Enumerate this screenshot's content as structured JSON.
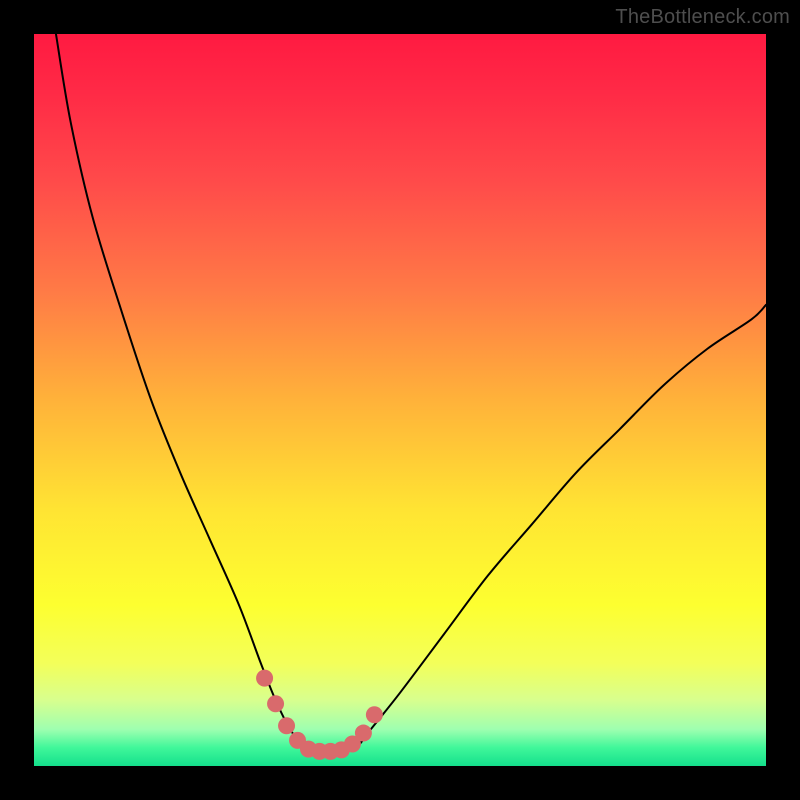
{
  "watermark": "TheBottleneck.com",
  "chart_data": {
    "type": "line",
    "title": "",
    "xlabel": "",
    "ylabel": "",
    "xlim": [
      0,
      100
    ],
    "ylim": [
      0,
      100
    ],
    "series": [
      {
        "name": "bottleneck-curve",
        "x": [
          3,
          5,
          8,
          12,
          16,
          20,
          24,
          28,
          31,
          33,
          35,
          37,
          39,
          42,
          44,
          46,
          50,
          56,
          62,
          68,
          74,
          80,
          86,
          92,
          98,
          100
        ],
        "values": [
          100,
          88,
          75,
          62,
          50,
          40,
          31,
          22,
          14,
          9,
          5,
          2.5,
          2,
          2,
          2.5,
          5,
          10,
          18,
          26,
          33,
          40,
          46,
          52,
          57,
          61,
          63
        ]
      }
    ],
    "highlight_points": {
      "name": "highlighted-segment",
      "color": "#d96a6c",
      "x": [
        31.5,
        33,
        34.5,
        36,
        37.5,
        39,
        40.5,
        42,
        43.5,
        45,
        46.5
      ],
      "values": [
        12,
        8.5,
        5.5,
        3.5,
        2.3,
        2,
        2,
        2.2,
        3,
        4.5,
        7
      ]
    },
    "gradient_stops": [
      {
        "offset": 0.0,
        "color": "#ff1a41"
      },
      {
        "offset": 0.08,
        "color": "#ff2a46"
      },
      {
        "offset": 0.2,
        "color": "#ff4a4a"
      },
      {
        "offset": 0.35,
        "color": "#ff7a46"
      },
      {
        "offset": 0.5,
        "color": "#ffb23a"
      },
      {
        "offset": 0.65,
        "color": "#ffe433"
      },
      {
        "offset": 0.78,
        "color": "#fdff30"
      },
      {
        "offset": 0.86,
        "color": "#f3ff5a"
      },
      {
        "offset": 0.91,
        "color": "#d8ff8e"
      },
      {
        "offset": 0.95,
        "color": "#9effb0"
      },
      {
        "offset": 0.975,
        "color": "#40f79a"
      },
      {
        "offset": 1.0,
        "color": "#14e08c"
      }
    ]
  }
}
